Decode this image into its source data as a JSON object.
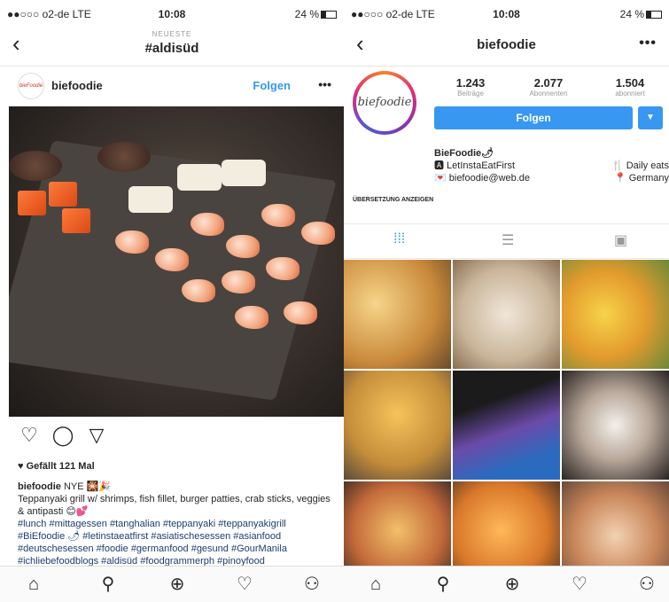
{
  "left": {
    "status": {
      "carrier": "●●○○○ o2-de  LTE",
      "time": "10:08",
      "battery": "24 %"
    },
    "nav": {
      "back": "‹",
      "subtitle": "NEUESTE",
      "title": "#aldisüd"
    },
    "post": {
      "avatar_text": "bieFoodie",
      "username": "biefoodie",
      "follow": "Folgen",
      "more": "•••",
      "likes": "Gefällt 121 Mal",
      "caption_user": "biefoodie",
      "caption_head": "NYE 🎇🎉",
      "caption_text": "Teppanyaki grill w/ shrimps, fish fillet, burger patties, crab sticks, veggies & antipasti 😊💕",
      "tags": "#lunch #mittagessen #tanghalian #teppanyaki #teppanyakigrill #BiEfoodie 🌶 #letinstaeatfirst #asiatischesessen #asianfood #deutschesessen #foodie #germanfood #gesund #GourManila #ichliebefoodblogs #aldisüd #foodgrammerph #pinoyfood"
    }
  },
  "right": {
    "status": {
      "carrier": "●●○○○ o2-de  LTE",
      "time": "10:08",
      "battery": "24 %"
    },
    "nav": {
      "back": "‹",
      "title": "biefoodie",
      "more": "•••"
    },
    "profile": {
      "logo": "biefoodie",
      "stats": [
        {
          "num": "1.243",
          "label": "Beiträge"
        },
        {
          "num": "2.077",
          "label": "Abonnenten"
        },
        {
          "num": "1.504",
          "label": "abonniert"
        }
      ],
      "follow_button": "Folgen",
      "dropdown": "▼",
      "bio_name": "BieFoodie🌶",
      "bio_line1": "🅰 LetInstaEatFirst",
      "bio_line2": "💌 biefoodie@web.de",
      "bio_right1": "🍴 Daily eats",
      "bio_right2": "📍 Germany",
      "translate": "ÜBERSETZUNG ANZEIGEN"
    }
  },
  "tabbar": {
    "home": "⌂",
    "search": "⚲",
    "add": "⊕",
    "heart": "♡",
    "profile": "⚇"
  },
  "colors": {
    "accent": "#3897f0",
    "text": "#262626"
  }
}
